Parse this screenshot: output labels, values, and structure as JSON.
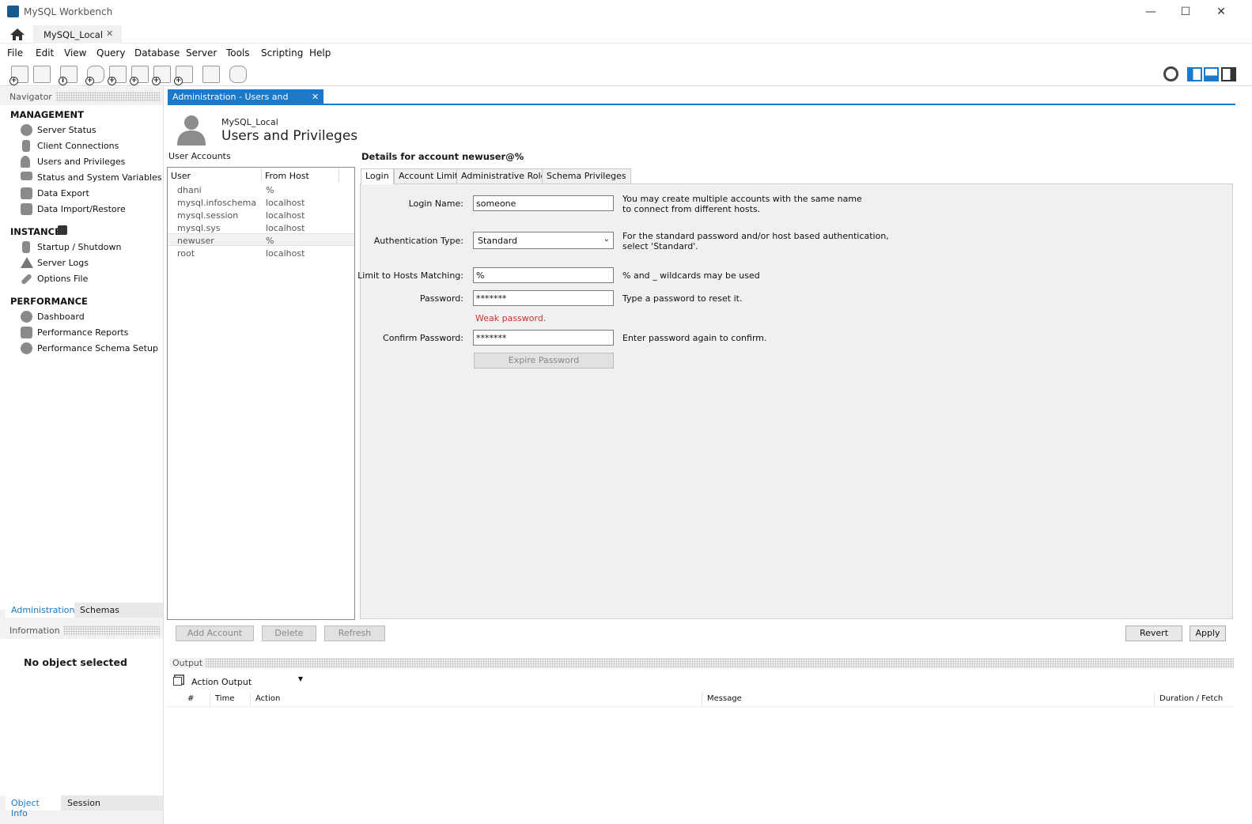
{
  "window": {
    "title": "MySQL Workbench"
  },
  "conn_tab": {
    "label": "MySQL_Local"
  },
  "menu": [
    "File",
    "Edit",
    "View",
    "Query",
    "Database",
    "Server",
    "Tools",
    "Scripting",
    "Help"
  ],
  "nav": {
    "title": "Navigator",
    "management_label": "MANAGEMENT",
    "management": [
      "Server Status",
      "Client Connections",
      "Users and Privileges",
      "Status and System Variables",
      "Data Export",
      "Data Import/Restore"
    ],
    "instance_label": "INSTANCE",
    "instance": [
      "Startup / Shutdown",
      "Server Logs",
      "Options File"
    ],
    "performance_label": "PERFORMANCE",
    "performance": [
      "Dashboard",
      "Performance Reports",
      "Performance Schema Setup"
    ],
    "bottom_tabs": [
      "Administration",
      "Schemas"
    ],
    "info_title": "Information",
    "info_text": "No object selected",
    "info_tabs": [
      "Object Info",
      "Session"
    ]
  },
  "doc_tab": {
    "label": "Administration - Users and Privil..."
  },
  "header": {
    "conn": "MySQL_Local",
    "title": "Users and Privileges"
  },
  "accounts": {
    "title": "User Accounts",
    "col_user": "User",
    "col_host": "From Host",
    "rows": [
      [
        "dhani",
        "%"
      ],
      [
        "mysql.infoschema",
        "localhost"
      ],
      [
        "mysql.session",
        "localhost"
      ],
      [
        "mysql.sys",
        "localhost"
      ],
      [
        "newuser",
        "%"
      ],
      [
        "root",
        "localhost"
      ]
    ],
    "buttons": [
      "Add Account",
      "Delete",
      "Refresh"
    ]
  },
  "details": {
    "title": "Details for account newuser@%",
    "tabs": [
      "Login",
      "Account Limits",
      "Administrative Roles",
      "Schema Privileges"
    ],
    "login_name_label": "Login Name:",
    "login_name": "someone",
    "login_help1": "You may create multiple accounts with the same name",
    "login_help2": "to connect from different hosts.",
    "auth_label": "Authentication Type:",
    "auth": "Standard",
    "auth_help1": "For the standard password and/or host based authentication,",
    "auth_help2": "select 'Standard'.",
    "hosts_label": "Limit to Hosts Matching:",
    "hosts": "%",
    "hosts_help": "% and _ wildcards may be used",
    "pwd_label": "Password:",
    "pwd": "*******",
    "pwd_help": "Type a password to reset it.",
    "weak": "Weak password.",
    "confirm_label": "Confirm Password:",
    "confirm": "*******",
    "confirm_help": "Enter password again to confirm.",
    "expire": "Expire Password",
    "revert": "Revert",
    "apply": "Apply"
  },
  "output": {
    "title": "Output",
    "selector": "Action Output",
    "cols": [
      "#",
      "Time",
      "Action",
      "Message",
      "Duration / Fetch"
    ]
  },
  "colors": {
    "accent": "#1979ca",
    "weak": "#c0392b"
  }
}
